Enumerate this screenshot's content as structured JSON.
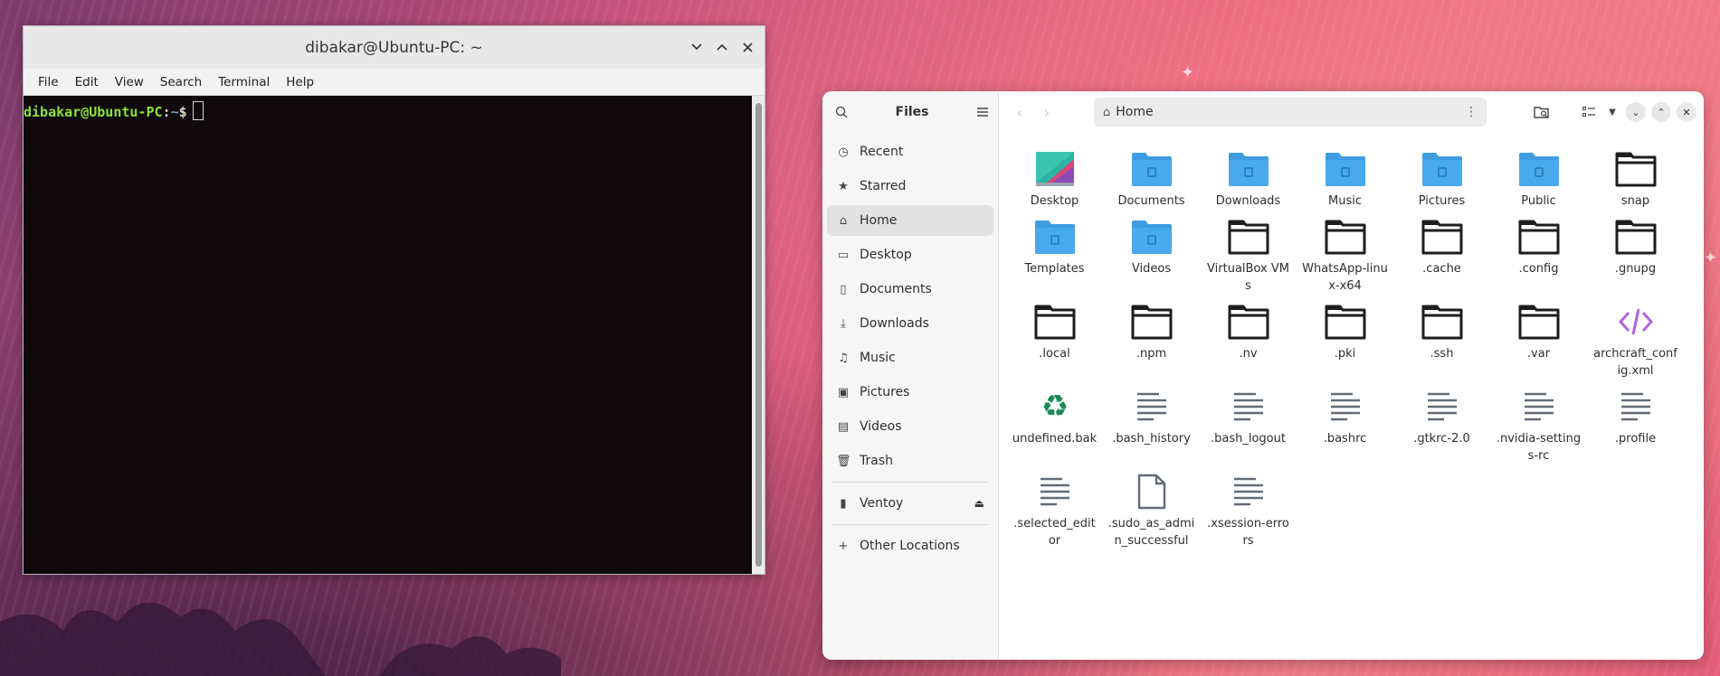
{
  "terminal": {
    "title": "dibakar@Ubuntu-PC: ~",
    "menu": [
      "File",
      "Edit",
      "View",
      "Search",
      "Terminal",
      "Help"
    ],
    "prompt_user": "dibakar@Ubuntu-PC",
    "prompt_sep": ":",
    "prompt_path": "~",
    "prompt_symbol": "$"
  },
  "files": {
    "title": "Files",
    "location": "Home",
    "sidebar": [
      {
        "label": "Recent",
        "icon": "clock-icon"
      },
      {
        "label": "Starred",
        "icon": "star-icon"
      },
      {
        "label": "Home",
        "icon": "home-icon"
      },
      {
        "label": "Desktop",
        "icon": "desktop-icon"
      },
      {
        "label": "Documents",
        "icon": "document-icon"
      },
      {
        "label": "Downloads",
        "icon": "download-icon"
      },
      {
        "label": "Music",
        "icon": "music-icon"
      },
      {
        "label": "Pictures",
        "icon": "picture-icon"
      },
      {
        "label": "Videos",
        "icon": "video-icon"
      },
      {
        "label": "Trash",
        "icon": "trash-icon"
      }
    ],
    "devices": [
      {
        "label": "Ventoy",
        "icon": "usb-drive-icon"
      }
    ],
    "other_locations": "Other Locations",
    "items": [
      {
        "label": "Desktop",
        "type": "desktop"
      },
      {
        "label": "Documents",
        "type": "folder-blue"
      },
      {
        "label": "Downloads",
        "type": "folder-blue"
      },
      {
        "label": "Music",
        "type": "folder-blue"
      },
      {
        "label": "Pictures",
        "type": "folder-blue"
      },
      {
        "label": "Public",
        "type": "folder-blue"
      },
      {
        "label": "snap",
        "type": "folder-black"
      },
      {
        "label": "Templates",
        "type": "folder-blue"
      },
      {
        "label": "Videos",
        "type": "folder-blue"
      },
      {
        "label": "VirtualBox VMs",
        "type": "folder-black"
      },
      {
        "label": "WhatsApp-linux-x64",
        "type": "folder-black"
      },
      {
        "label": ".cache",
        "type": "folder-black"
      },
      {
        "label": ".config",
        "type": "folder-black"
      },
      {
        "label": ".gnupg",
        "type": "folder-black"
      },
      {
        "label": ".local",
        "type": "folder-black"
      },
      {
        "label": ".npm",
        "type": "folder-black"
      },
      {
        "label": ".nv",
        "type": "folder-black"
      },
      {
        "label": ".pki",
        "type": "folder-black"
      },
      {
        "label": ".ssh",
        "type": "folder-black"
      },
      {
        "label": ".var",
        "type": "folder-black"
      },
      {
        "label": "archcraft_config.xml",
        "type": "code"
      },
      {
        "label": "undefined.bak",
        "type": "recycle"
      },
      {
        "label": ".bash_history",
        "type": "text"
      },
      {
        "label": ".bash_logout",
        "type": "text"
      },
      {
        "label": ".bashrc",
        "type": "text"
      },
      {
        "label": ".gtkrc-2.0",
        "type": "text"
      },
      {
        "label": ".nvidia-settings-rc",
        "type": "text"
      },
      {
        "label": ".profile",
        "type": "text"
      },
      {
        "label": ".selected_editor",
        "type": "text"
      },
      {
        "label": ".sudo_as_admin_successful",
        "type": "blank"
      },
      {
        "label": ".xsession-errors",
        "type": "text"
      }
    ]
  },
  "colors": {
    "folder_blue": "#3d9de0",
    "folder_black": "#1e1e1e",
    "terminal_bg": "#0f090c",
    "prompt_user": "#8ae234",
    "prompt_path": "#729fcf"
  }
}
